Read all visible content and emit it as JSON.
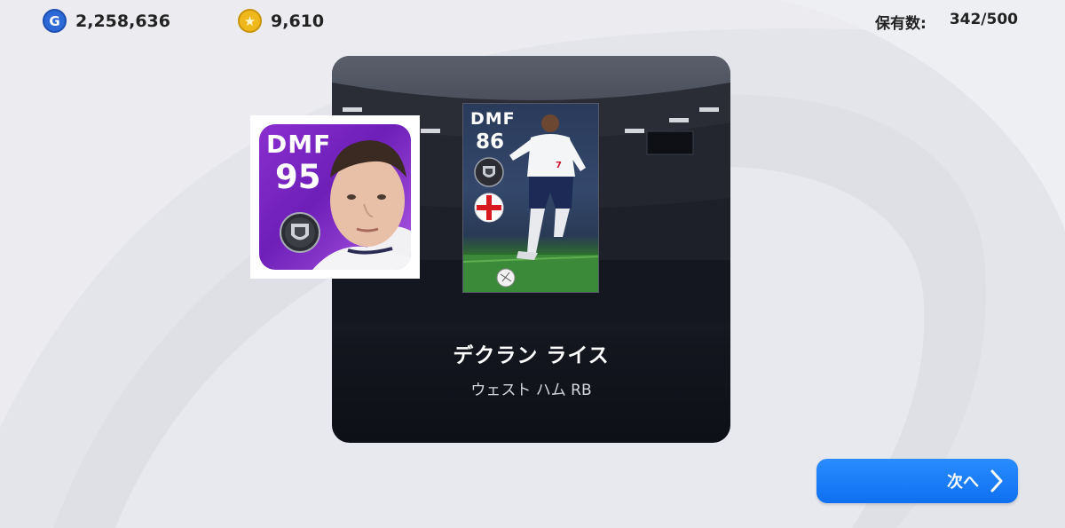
{
  "currency": {
    "gp_icon": "G",
    "gp_value": "2,258,636",
    "coin_icon": "★",
    "coin_value": "9,610"
  },
  "holdings": {
    "label": "保有数:",
    "value": "342/500"
  },
  "icon_card": {
    "position": "DMF",
    "rating": "95",
    "theme_color": "#8a2fd0"
  },
  "player_card": {
    "position": "DMF",
    "rating": "86",
    "kit_number": "7"
  },
  "player": {
    "name": "デクラン ライス",
    "team": "ウェスト ハム RB"
  },
  "next_button": {
    "label": "次へ",
    "icon": "chevron-right-icon",
    "color": "#1a7ef8"
  }
}
